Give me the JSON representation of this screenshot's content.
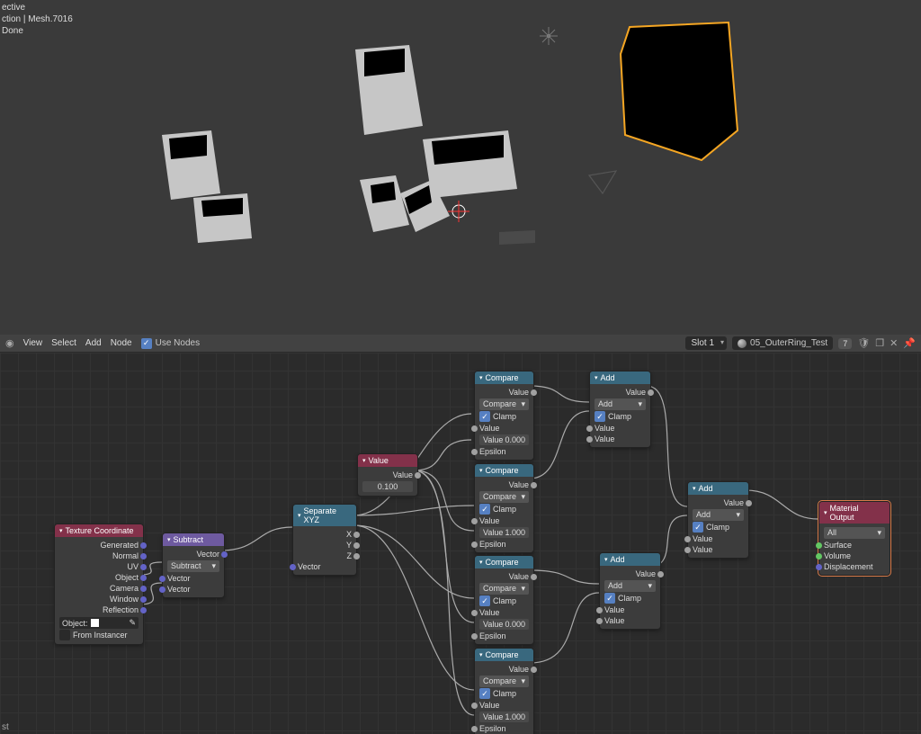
{
  "viewport": {
    "line1": "ective",
    "line2": "ction | Mesh.7016",
    "line3": "Done"
  },
  "header": {
    "menus": [
      "View",
      "Select",
      "Add",
      "Node"
    ],
    "use_nodes": "Use Nodes",
    "slot": "Slot 1",
    "material": "05_OuterRing_Test",
    "users": "7"
  },
  "nodes": {
    "tex_coord": {
      "title": "Texture Coordinate",
      "outs": [
        "Generated",
        "Normal",
        "UV",
        "Object",
        "Camera",
        "Window",
        "Reflection"
      ],
      "obj_label": "Object:",
      "from_inst": "From Instancer"
    },
    "subtract": {
      "title": "Subtract",
      "out": "Vector",
      "mode": "Subtract",
      "in1": "Vector",
      "in2": "Vector"
    },
    "sepxyz": {
      "title": "Separate XYZ",
      "outs": [
        "X",
        "Y",
        "Z"
      ],
      "in": "Vector"
    },
    "value_node": {
      "title": "Value",
      "out": "Value",
      "val": "0.100"
    },
    "compare": {
      "title": "Compare",
      "out": "Value",
      "mode": "Compare",
      "clamp": "Clamp",
      "vlabel": "Value",
      "eps": "Epsilon",
      "v0": "0.000",
      "v1": "1.000"
    },
    "add": {
      "title": "Add",
      "out": "Value",
      "mode": "Add",
      "clamp": "Clamp",
      "vlabel": "Value"
    },
    "matout": {
      "title": "Material Output",
      "target": "All",
      "ins": [
        "Surface",
        "Volume",
        "Displacement"
      ]
    }
  },
  "bottom": {
    "text": "st"
  }
}
